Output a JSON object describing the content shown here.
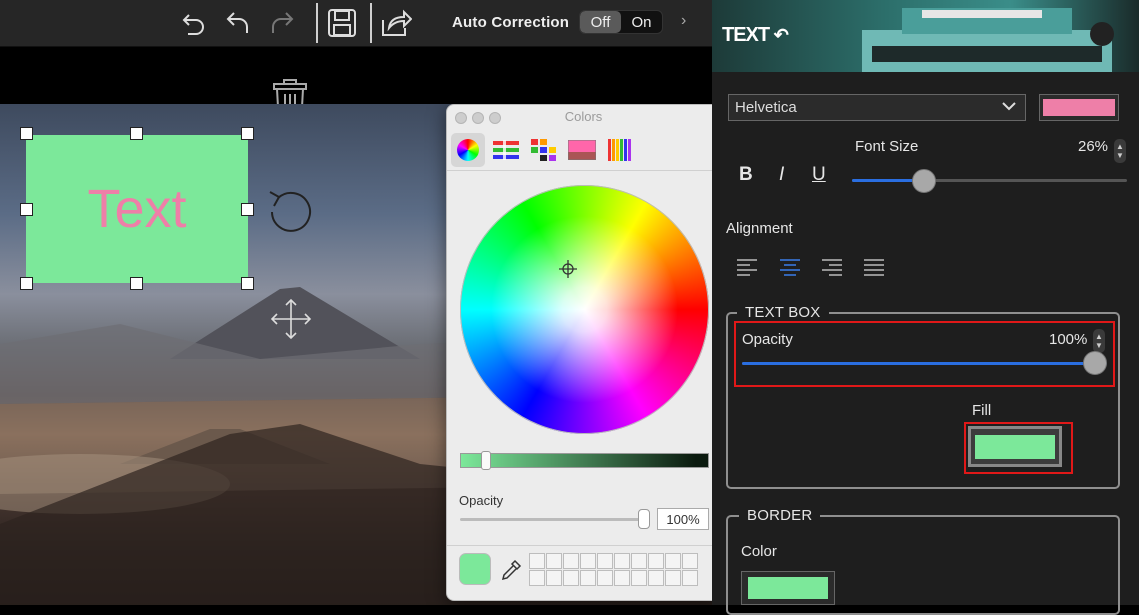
{
  "toolbar": {
    "autocorrection_label": "Auto Correction",
    "toggle_off": "Off",
    "toggle_on": "On",
    "icons": [
      "undo-icon",
      "undo-all-icon",
      "redo-icon",
      "save-icon",
      "share-icon",
      "chevron-right-icon"
    ]
  },
  "canvas": {
    "text_box_text": "Text",
    "text_box_fill": "#7ce89a",
    "text_color": "#ee7fa8"
  },
  "colors_window": {
    "title": "Colors",
    "tabs": [
      "color-wheel",
      "color-sliders",
      "color-palettes",
      "image-palettes",
      "pencils"
    ],
    "opacity_label": "Opacity",
    "opacity_value": "100%",
    "current_color": "#7ce89a"
  },
  "panel": {
    "banner_title": "TEXT",
    "font_family": "Helvetica",
    "font_color": "#ee7fa8",
    "font_size_label": "Font Size",
    "font_size_value": "26%",
    "font_size_fraction": 0.26,
    "bold": "B",
    "italic": "I",
    "underline": "U",
    "alignment_label": "Alignment",
    "text_box_title": "TEXT BOX",
    "opacity_label": "Opacity",
    "opacity_value": "100%",
    "opacity_fraction": 1.0,
    "fill_label": "Fill",
    "fill_color": "#7ce89a",
    "border_title": "BORDER",
    "border_color_label": "Color",
    "border_color": "#7ce89a"
  }
}
